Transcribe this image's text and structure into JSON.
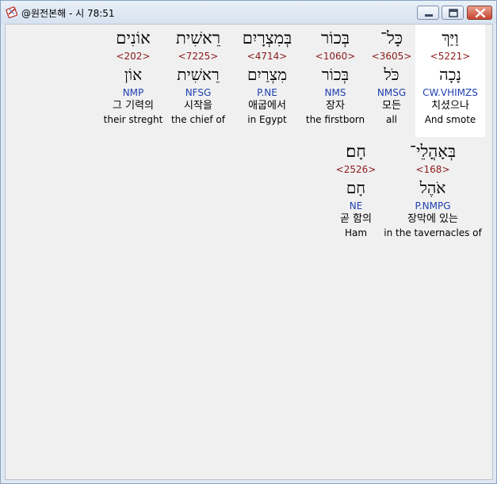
{
  "window": {
    "title": "@원전본해 - 시 78:51",
    "icon": "bible-app-icon",
    "controls": [
      "minimize-icon",
      "maximize-icon",
      "close-icon"
    ]
  },
  "colors": {
    "strongs": "#8b1a1a",
    "parsing": "#1f3fb0",
    "selected_bg": "#ffffff"
  },
  "words": [
    {
      "hebrew": "וַיַּךְ",
      "strongs": "<5221>",
      "lemma": "נָכָה",
      "parsing": "CW.VHIMZS",
      "korean": "치셨으나",
      "english": "And smote",
      "selected": true
    },
    {
      "hebrew": "כָּל־",
      "strongs": "<3605>",
      "lemma": "כֹּל",
      "parsing": "NMSG",
      "korean": "모든",
      "english": "all"
    },
    {
      "hebrew": "בְּכוֹר",
      "strongs": "<1060>",
      "lemma": "בְּכוֹר",
      "parsing": "NMS",
      "korean": "장자",
      "english": "the firstborn"
    },
    {
      "hebrew": "בְּמִצְרָיִם",
      "strongs": "<4714>",
      "lemma": "מִצְרַיִם",
      "parsing": "P.NE",
      "korean": "애굽에서",
      "english": "in Egypt"
    },
    {
      "hebrew": "רֵאשִׁית",
      "strongs": "<7225>",
      "lemma": "רֵאשִׁית",
      "parsing": "NFSG",
      "korean": "시작을",
      "english": "the chief of"
    },
    {
      "hebrew": "אוֹנִים",
      "strongs": "<202>",
      "lemma": "אוֹן",
      "parsing": "NMP",
      "korean": "그 기력의",
      "english": "their streght"
    },
    {
      "hebrew": "בְּאָהֳלֵי־",
      "strongs": "<168>",
      "lemma": "אֹהֶל",
      "parsing": "P.NMPG",
      "korean": "장막에 있는",
      "english": "in the tavernacles of"
    },
    {
      "hebrew": "חָם׃",
      "strongs": "<2526>",
      "lemma": "חָם",
      "parsing": "NE",
      "korean": "곧 함의",
      "english": "Ham"
    }
  ]
}
